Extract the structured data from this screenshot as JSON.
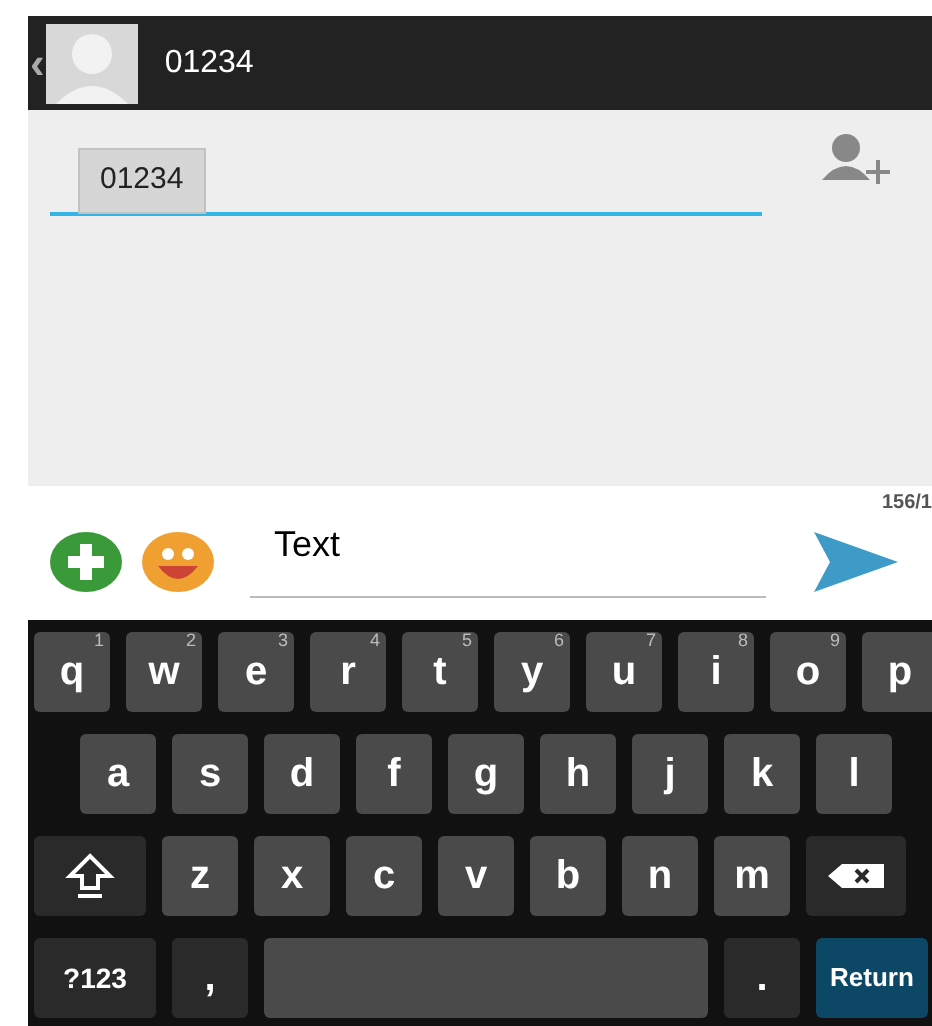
{
  "header": {
    "back": "‹",
    "title": "01234"
  },
  "recipients": {
    "chips": [
      "01234"
    ]
  },
  "compose": {
    "counter": "156/1",
    "value": "Text"
  },
  "keyboard": {
    "letter_row_1": {
      "keys": [
        {
          "kind": "letter",
          "label": "q",
          "hint": "1"
        },
        {
          "kind": "letter",
          "label": "w",
          "hint": "2"
        },
        {
          "kind": "letter",
          "label": "e",
          "hint": "3"
        },
        {
          "kind": "letter",
          "label": "r",
          "hint": "4"
        },
        {
          "kind": "letter",
          "label": "t",
          "hint": "5"
        },
        {
          "kind": "letter",
          "label": "y",
          "hint": "6"
        },
        {
          "kind": "letter",
          "label": "u",
          "hint": "7"
        },
        {
          "kind": "letter",
          "label": "i",
          "hint": "8"
        },
        {
          "kind": "letter",
          "label": "o",
          "hint": "9"
        },
        {
          "kind": "letter",
          "label": "p"
        }
      ]
    },
    "letter_row_2": {
      "keys": [
        {
          "kind": "letter",
          "label": "a"
        },
        {
          "kind": "letter",
          "label": "s"
        },
        {
          "kind": "letter",
          "label": "d"
        },
        {
          "kind": "letter",
          "label": "f"
        },
        {
          "kind": "letter",
          "label": "g"
        },
        {
          "kind": "letter",
          "label": "h"
        },
        {
          "kind": "letter",
          "label": "j"
        },
        {
          "kind": "letter",
          "label": "k"
        },
        {
          "kind": "letter",
          "label": "l"
        }
      ]
    },
    "letter_row_3": {
      "keys": [
        {
          "kind": "shift"
        },
        {
          "kind": "letter",
          "label": "z"
        },
        {
          "kind": "letter",
          "label": "x"
        },
        {
          "kind": "letter",
          "label": "c"
        },
        {
          "kind": "letter",
          "label": "v"
        },
        {
          "kind": "letter",
          "label": "b"
        },
        {
          "kind": "letter",
          "label": "n"
        },
        {
          "kind": "letter",
          "label": "m"
        },
        {
          "kind": "delete"
        }
      ]
    },
    "bottom_row": {
      "keys": [
        {
          "kind": "symbols",
          "label": "?123"
        },
        {
          "kind": "punct",
          "label": ","
        },
        {
          "kind": "space"
        },
        {
          "kind": "punct",
          "label": "."
        },
        {
          "kind": "return",
          "label": "Return"
        }
      ]
    }
  }
}
